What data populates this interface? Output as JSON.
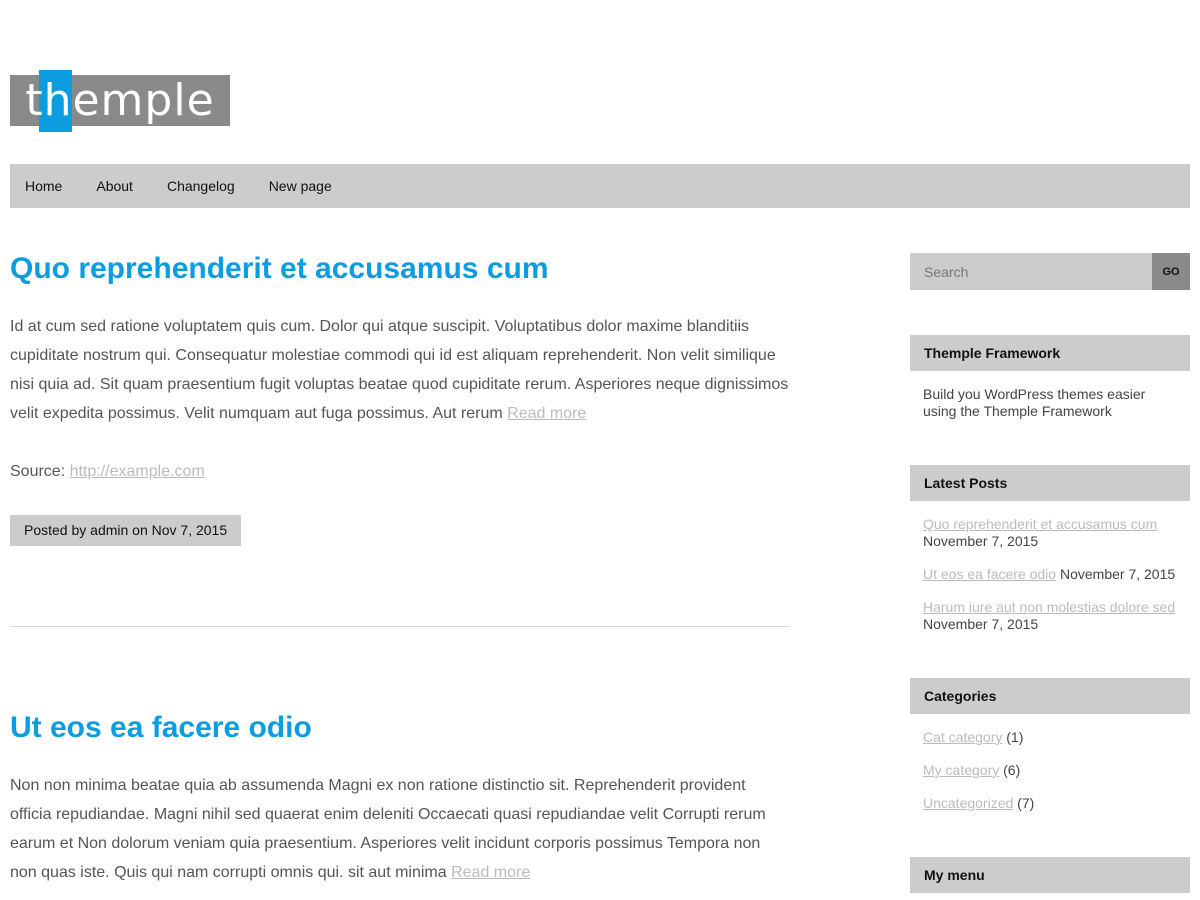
{
  "logo": {
    "text": "themple"
  },
  "nav": {
    "items": [
      {
        "label": "Home"
      },
      {
        "label": "About"
      },
      {
        "label": "Changelog"
      },
      {
        "label": "New page"
      }
    ]
  },
  "posts": [
    {
      "title": "Quo reprehenderit et accusamus cum",
      "excerpt": "Id at cum sed ratione voluptatem quis cum. Dolor qui atque suscipit. Voluptatibus dolor maxime blanditiis cupiditate nostrum qui. Consequatur molestiae commodi qui id est aliquam reprehenderit. Non velit similique nisi quia ad. Sit quam praesentium fugit voluptas beatae quod cupiditate rerum. Asperiores neque dignissimos velit expedita possimus. Velit numquam aut fuga possimus. Aut rerum",
      "read_more": "Read more",
      "source_label": "Source:",
      "source_link": "http://example.com",
      "meta": "Posted by admin on Nov 7, 2015"
    },
    {
      "title": "Ut eos ea facere odio",
      "excerpt": "Non non minima beatae quia ab assumenda Magni ex non ratione distinctio sit. Reprehenderit provident officia repudiandae. Magni nihil sed quaerat enim deleniti Occaecati quasi repudiandae velit Corrupti rerum earum et Non dolorum veniam quia praesentium. Asperiores velit incidunt corporis possimus Tempora non non quas iste. Quis qui nam corrupti omnis qui. sit aut minima",
      "read_more": "Read more"
    }
  ],
  "sidebar": {
    "search": {
      "placeholder": "Search",
      "button": "GO"
    },
    "framework": {
      "title": "Themple Framework",
      "text": "Build you WordPress themes easier using the Themple Framework"
    },
    "latest": {
      "title": "Latest Posts",
      "items": [
        {
          "link": "Quo reprehenderit et accusamus cum",
          "date": "November 7, 2015"
        },
        {
          "link": "Ut eos ea facere odio",
          "date": "November 7, 2015"
        },
        {
          "link": "Harum iure aut non molestias dolore sed",
          "date": "November 7, 2015"
        }
      ]
    },
    "categories": {
      "title": "Categories",
      "items": [
        {
          "link": "Cat category",
          "count": "(1)"
        },
        {
          "link": "My category",
          "count": "(6)"
        },
        {
          "link": "Uncategorized",
          "count": "(7)"
        }
      ]
    },
    "menu": {
      "title": "My menu"
    }
  },
  "colors": {
    "accent": "#0b9de0",
    "bar": "#cccccc",
    "logo_gray": "#8a8a8a"
  }
}
